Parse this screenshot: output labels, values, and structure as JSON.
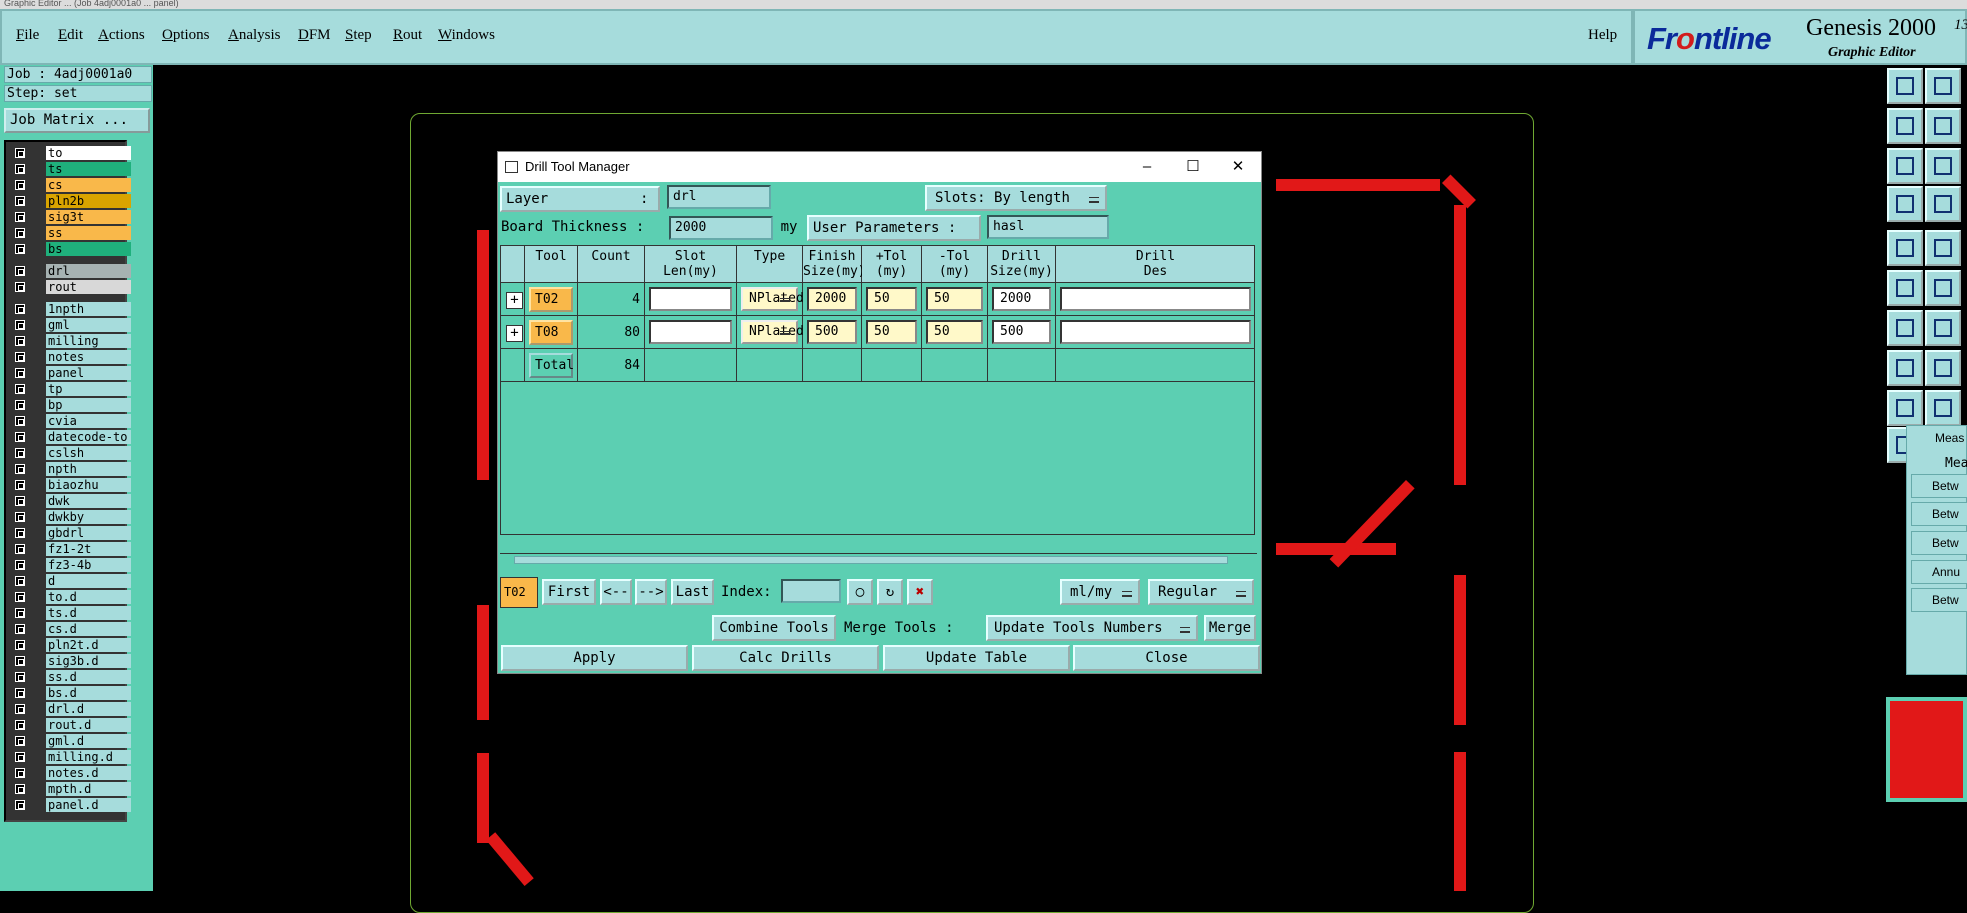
{
  "window": {
    "title": "Graphic Editor ... (Job 4adj0001a0 ... panel)"
  },
  "menu": {
    "items": [
      "File",
      "Edit",
      "Actions",
      "Options",
      "Analysis",
      "DFM",
      "Step",
      "Rout",
      "Windows"
    ],
    "help": "Help"
  },
  "brand": {
    "logo_a": "Fr",
    "logo_o": "o",
    "logo_b": "ntline",
    "product": "Genesis 2000",
    "subtitle": "Graphic Editor",
    "version": "13"
  },
  "job": {
    "job_label": "Job : 4adj0001a0",
    "step_label": "Step: set",
    "matrix_button": "Job Matrix ..."
  },
  "layers": [
    {
      "name": "to",
      "color": "#ffffff"
    },
    {
      "name": "ts",
      "color": "#1fb07c"
    },
    {
      "name": "cs",
      "color": "#f9b84a"
    },
    {
      "name": "pln2b",
      "color": "#d9a400"
    },
    {
      "name": "sig3t",
      "color": "#f9b84a"
    },
    {
      "name": "ss",
      "color": "#f9b84a"
    },
    {
      "name": "bs",
      "color": "#1fb07c"
    },
    {
      "name": "drl",
      "color": "#a6b2b2"
    },
    {
      "name": "rout",
      "color": "#d8d8d8"
    },
    {
      "name": "1npth",
      "color": "#a6dcdc"
    },
    {
      "name": "gml",
      "color": "#a6dcdc"
    },
    {
      "name": "milling",
      "color": "#a6dcdc"
    },
    {
      "name": "notes",
      "color": "#a6dcdc"
    },
    {
      "name": "panel",
      "color": "#a6dcdc"
    },
    {
      "name": "tp",
      "color": "#a6dcdc"
    },
    {
      "name": "bp",
      "color": "#a6dcdc"
    },
    {
      "name": "cvia",
      "color": "#a6dcdc"
    },
    {
      "name": "datecode-to",
      "color": "#a6dcdc"
    },
    {
      "name": "cslsh",
      "color": "#a6dcdc"
    },
    {
      "name": "npth",
      "color": "#a6dcdc"
    },
    {
      "name": "biaozhu",
      "color": "#a6dcdc"
    },
    {
      "name": "dwk",
      "color": "#a6dcdc"
    },
    {
      "name": "dwkby",
      "color": "#a6dcdc"
    },
    {
      "name": "gbdrl",
      "color": "#a6dcdc"
    },
    {
      "name": "fz1-2t",
      "color": "#a6dcdc"
    },
    {
      "name": "fz3-4b",
      "color": "#a6dcdc"
    },
    {
      "name": "d",
      "color": "#a6dcdc"
    },
    {
      "name": "to.d",
      "color": "#a6dcdc"
    },
    {
      "name": "ts.d",
      "color": "#a6dcdc"
    },
    {
      "name": "cs.d",
      "color": "#a6dcdc"
    },
    {
      "name": "pln2t.d",
      "color": "#a6dcdc"
    },
    {
      "name": "sig3b.d",
      "color": "#a6dcdc"
    },
    {
      "name": "ss.d",
      "color": "#a6dcdc"
    },
    {
      "name": "bs.d",
      "color": "#a6dcdc"
    },
    {
      "name": "drl.d",
      "color": "#a6dcdc"
    },
    {
      "name": "rout.d",
      "color": "#a6dcdc"
    },
    {
      "name": "gml.d",
      "color": "#a6dcdc"
    },
    {
      "name": "milling.d",
      "color": "#a6dcdc"
    },
    {
      "name": "notes.d",
      "color": "#a6dcdc"
    },
    {
      "name": "mpth.d",
      "color": "#a6dcdc"
    },
    {
      "name": "panel.d",
      "color": "#a6dcdc"
    }
  ],
  "dialog": {
    "title": "Drill Tool Manager",
    "layer_label": "Layer",
    "layer_colon": ":",
    "layer_value": "drl",
    "slots_label": "Slots:",
    "slots_value": "By length",
    "thickness_label": "Board Thickness :",
    "thickness_value": "2000",
    "thickness_unit": "my",
    "user_params_label": "User Parameters :",
    "user_params_value": "hasl",
    "columns": [
      "Tool",
      "Count",
      "Slot\nLen(my)",
      "Type",
      "Finish\nSize(my)",
      "+Tol\n(my)",
      "-Tol\n(my)",
      "Drill\nSize(my)",
      "Drill\nDes"
    ],
    "rows": [
      {
        "tool": "T02",
        "count": "4",
        "slot_len": "",
        "type": "NPlated",
        "finish": "2000",
        "ptol": "50",
        "mtol": "50",
        "drill": "2000",
        "des": ""
      },
      {
        "tool": "T08",
        "count": "80",
        "slot_len": "",
        "type": "NPlated",
        "finish": "500",
        "ptol": "50",
        "mtol": "50",
        "drill": "500",
        "des": ""
      }
    ],
    "total_label": "Total",
    "total_count": "84",
    "current_tool": "T02",
    "nav": {
      "first": "First",
      "prev": "<--",
      "next": "-->",
      "last": "Last",
      "index_label": "Index:"
    },
    "units_value": "ml/my",
    "mode_value": "Regular",
    "combine": "Combine Tools",
    "merge_label": "Merge Tools :",
    "update_numbers": "Update Tools Numbers",
    "merge": "Merge",
    "apply": "Apply",
    "calc": "Calc Drills",
    "update_table": "Update Table",
    "close": "Close"
  },
  "measure": {
    "title": "Meas",
    "header": "Mea",
    "items": [
      "Betw",
      "Betw",
      "Betw",
      "Annu",
      "Betw"
    ]
  },
  "colors": {
    "accent": "#5ccfb2",
    "panel": "#a6dcdc",
    "trace": "#e11818"
  }
}
